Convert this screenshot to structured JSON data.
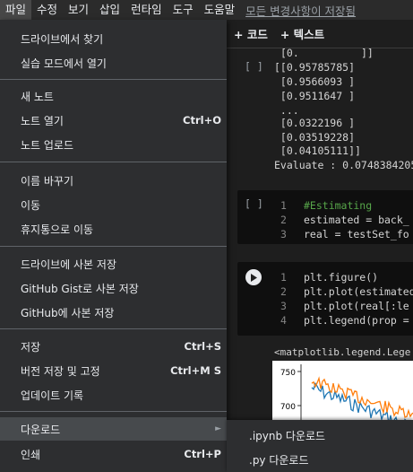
{
  "menubar": {
    "items": [
      "파일",
      "수정",
      "보기",
      "삽입",
      "런타임",
      "도구",
      "도움말"
    ],
    "saved_status": "모든 변경사항이 저장됨"
  },
  "toolbar": {
    "add_code": "+ 코드",
    "add_text": "+ 텍스트"
  },
  "output": {
    "run_bracket": "[ ]",
    "lines": [
      "[0.          ]]",
      "[[0.95785785]",
      " [0.9566093 ]",
      " [0.9511647 ]",
      " ...",
      " [0.0322196 ]",
      " [0.03519228]",
      " [0.04105111]]",
      "Evaluate : 0.0748384205"
    ]
  },
  "cell1": {
    "run_bracket": "[ ]",
    "line_numbers": [
      "1",
      "2",
      "3"
    ],
    "lines": [
      "#Estimating",
      "estimated = back_",
      "real = testSet_fo"
    ]
  },
  "cell2": {
    "line_numbers": [
      "1",
      "2",
      "3",
      "4"
    ],
    "lines": [
      "plt.figure()",
      "plt.plot(estimated",
      "plt.plot(real[:le",
      "plt.legend(prop ="
    ]
  },
  "cell2_output": {
    "text": "<matplotlib.legend.Lege",
    "ytick_750": "750",
    "ytick_700": "700"
  },
  "chart_data": {
    "type": "line",
    "yticks": [
      "750",
      "700"
    ],
    "series_colors": [
      "#1f77b4",
      "#ff7f0e"
    ]
  },
  "file_menu": {
    "open_drive": "드라이브에서 찾기",
    "open_playground": "실습 모드에서 열기",
    "new_notebook": "새 노트",
    "open_notebook": "노트 열기",
    "open_notebook_shortcut": "Ctrl+O",
    "upload_notebook": "노트 업로드",
    "rename": "이름 바꾸기",
    "move": "이동",
    "move_to_trash": "휴지통으로 이동",
    "save_copy_drive": "드라이브에 사본 저장",
    "save_copy_gist": "GitHub Gist로 사본 저장",
    "save_copy_github": "GitHub에 사본 저장",
    "save": "저장",
    "save_shortcut": "Ctrl+S",
    "save_pin": "버전 저장 및 고정",
    "save_pin_shortcut": "Ctrl+M S",
    "revision_history": "업데이트 기록",
    "download": "다운로드",
    "print": "인쇄",
    "print_shortcut": "Ctrl+P"
  },
  "download_submenu": {
    "ipynb": ".ipynb 다운로드",
    "py": ".py 다운로드"
  }
}
